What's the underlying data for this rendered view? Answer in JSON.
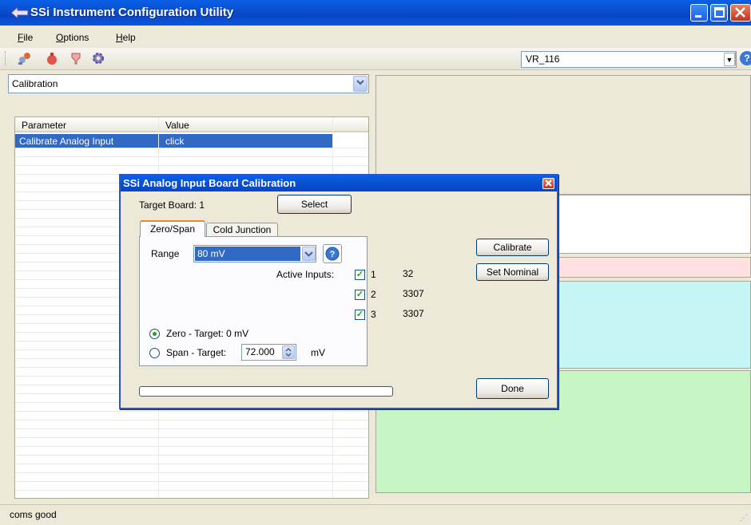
{
  "window": {
    "title": "SSi Instrument Configuration Utility"
  },
  "menu": {
    "items": [
      "File",
      "Options",
      "Help"
    ]
  },
  "toolbar": {
    "instrument_value": "VR_116"
  },
  "left": {
    "category_value": "Calibration",
    "grid": {
      "columns": [
        "Parameter",
        "Value"
      ],
      "rows": [
        {
          "parameter": "Calibrate Analog Input",
          "value": "click"
        }
      ]
    }
  },
  "dialog": {
    "title": "SSi Analog Input Board Calibration",
    "target_board_label": "Target Board: 1",
    "select_label": "Select",
    "tabs": [
      "Zero/Span",
      "Cold Junction"
    ],
    "range_label": "Range",
    "range_value": "80 mV",
    "active_inputs_label": "Active Inputs:",
    "inputs": [
      {
        "number": "1",
        "checked": true,
        "value": "32"
      },
      {
        "number": "2",
        "checked": true,
        "value": "3307"
      },
      {
        "number": "3",
        "checked": true,
        "value": "3307"
      }
    ],
    "zero_label": "Zero - Target: 0 mV",
    "span_label": "Span - Target:",
    "span_value": "72.000",
    "span_unit": "mV",
    "calibrate_label": "Calibrate",
    "set_nominal_label": "Set Nominal",
    "done_label": "Done",
    "progress": 0
  },
  "status": {
    "text": "coms good"
  },
  "colors": {
    "selection": "#316ac5",
    "panel_pink": "#ffe1e1",
    "panel_cyan": "#c6f5f6",
    "panel_green": "#c8f5c4",
    "title_blue": "#0a4fd0"
  }
}
